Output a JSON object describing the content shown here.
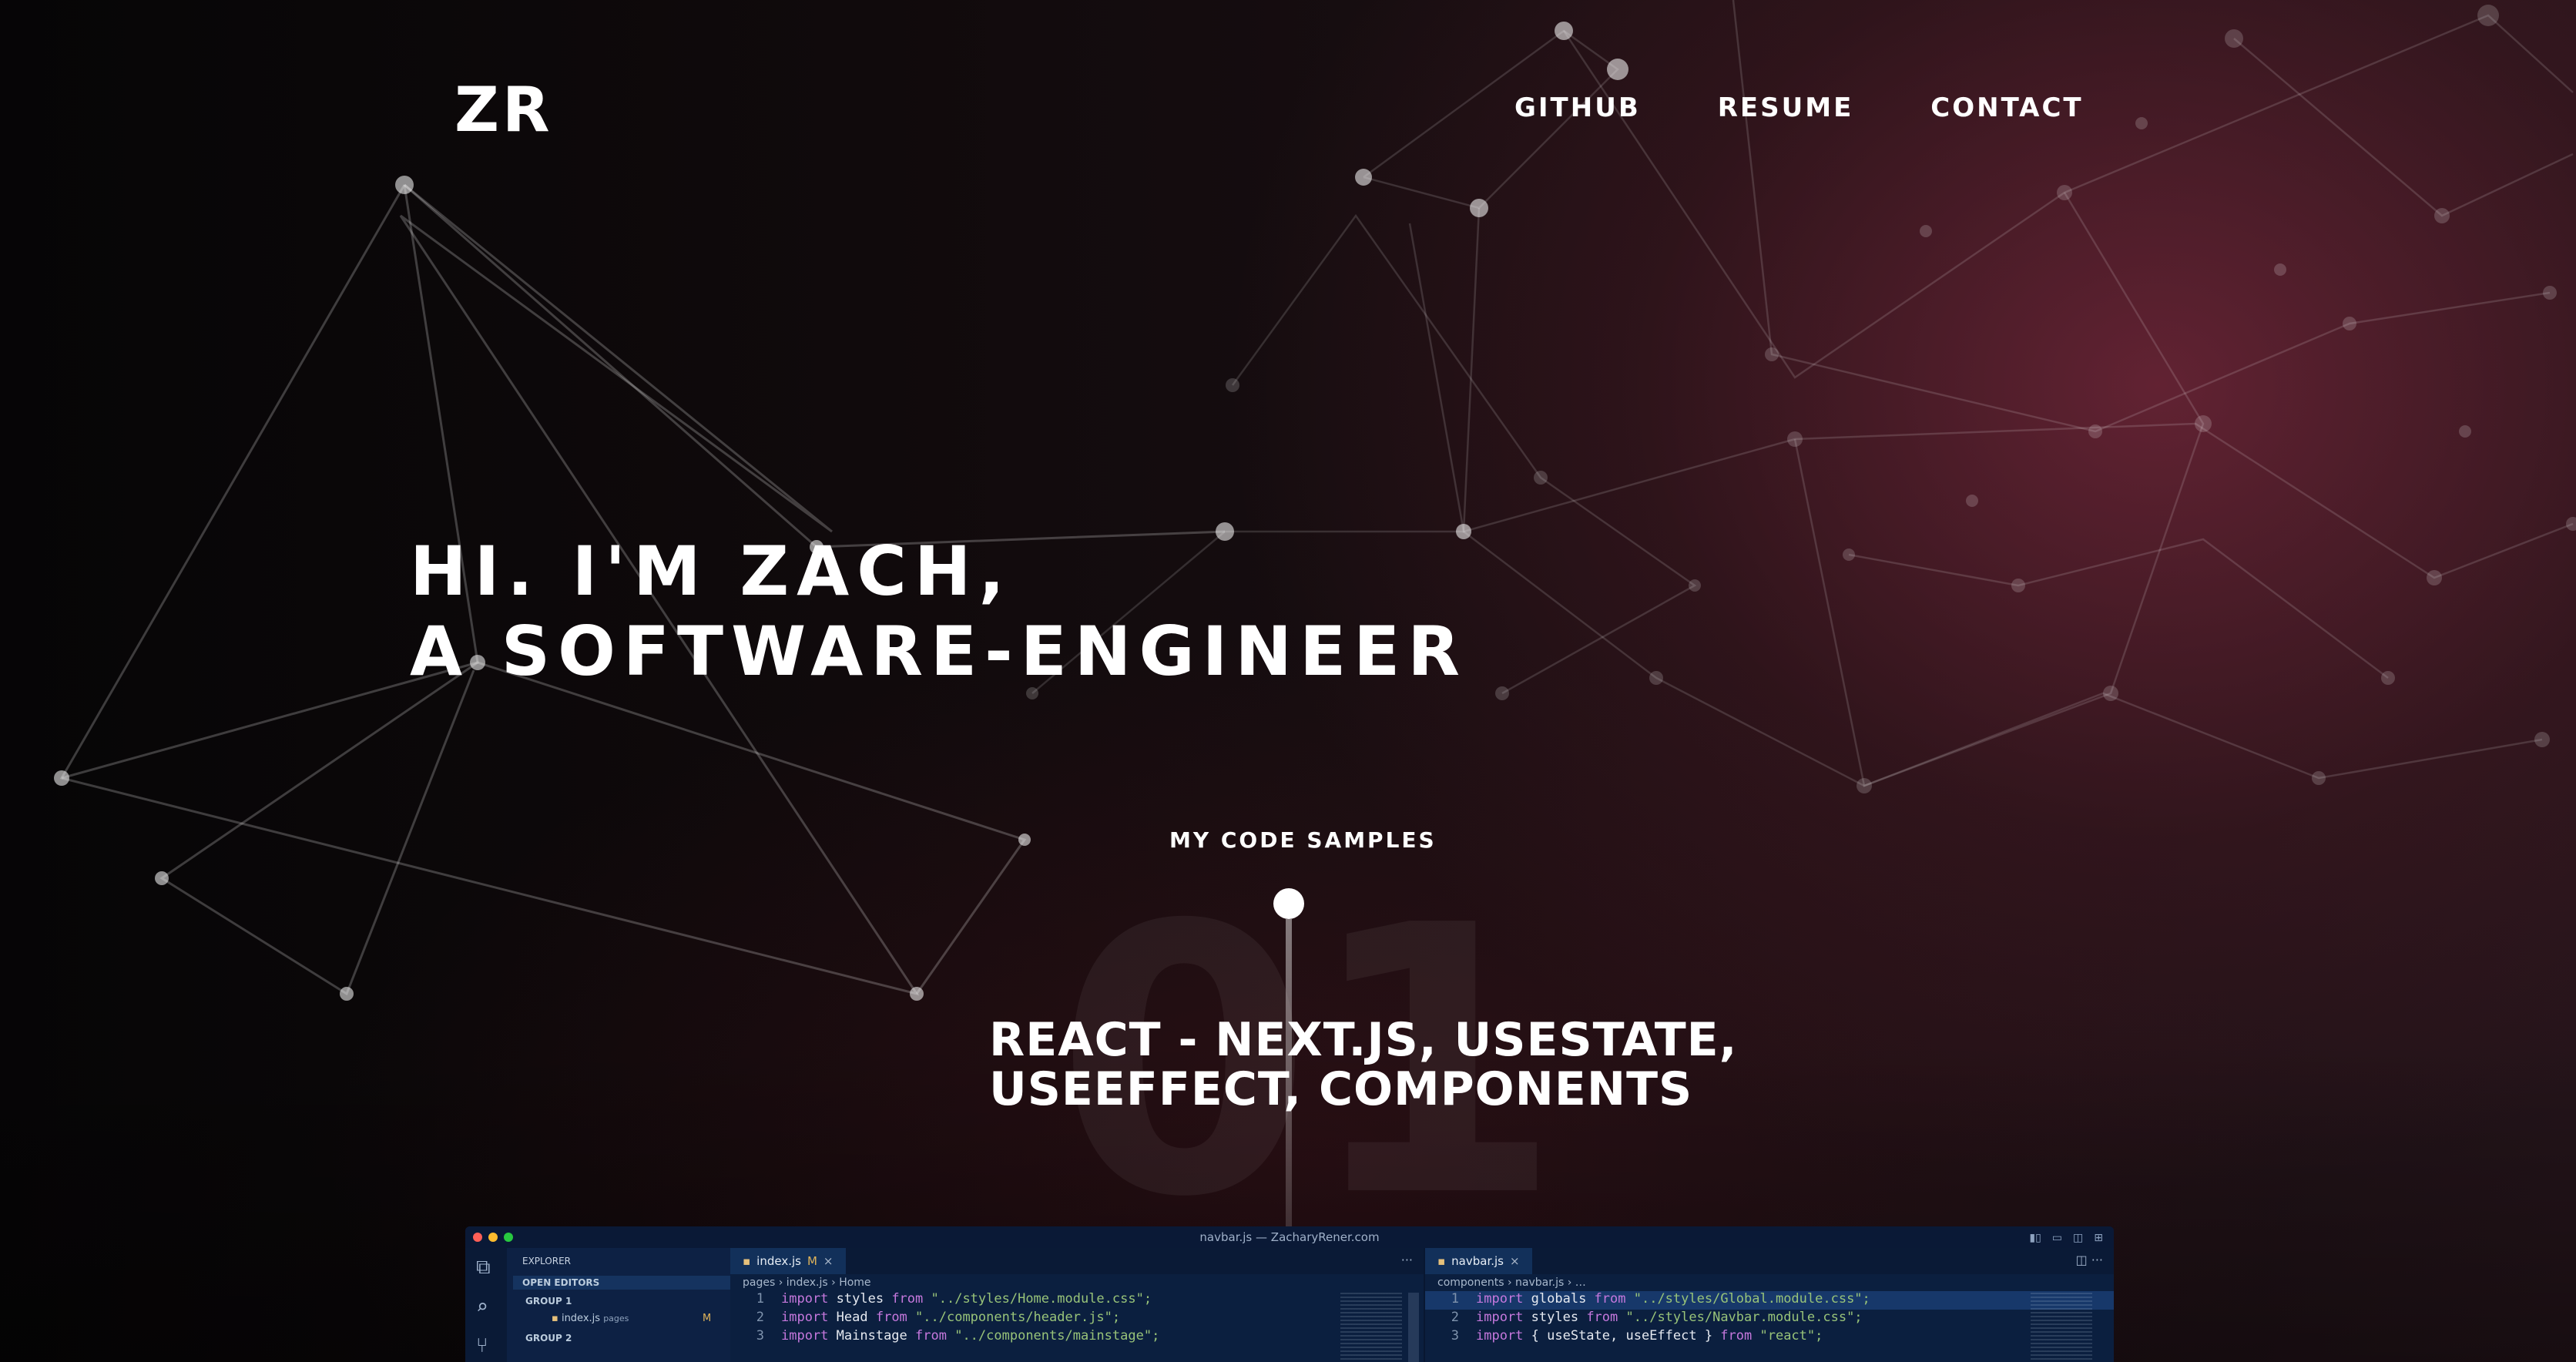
{
  "header": {
    "logo": "ZR",
    "nav": [
      {
        "label": "GITHUB"
      },
      {
        "label": "RESUME"
      },
      {
        "label": "CONTACT"
      }
    ]
  },
  "hero": {
    "line1": "HI. I'M ZACH,",
    "line2": "A SOFTWARE-ENGINEER"
  },
  "samples": {
    "label": "MY CODE SAMPLES",
    "number": "01",
    "title_line1": "REACT - NEXT.JS, USESTATE,",
    "title_line2": "USEEFFECT, COMPONENTS"
  },
  "editor": {
    "window_title": "navbar.js — ZacharyRener.com",
    "explorer": {
      "title": "EXPLORER",
      "open_editors": "OPEN EDITORS",
      "group1": "GROUP 1",
      "file": "index.js",
      "file_folder": "pages",
      "file_status": "M",
      "group2": "GROUP 2"
    },
    "left_pane": {
      "tab": "index.js",
      "tab_status": "M",
      "crumb": "pages › index.js › Home",
      "lines": [
        {
          "n": "1",
          "kw": "import",
          "id": " styles ",
          "kw2": "from",
          "str": " \"../styles/Home.module.css\";"
        },
        {
          "n": "2",
          "kw": "import",
          "id": " Head ",
          "kw2": "from",
          "str": " \"../components/header.js\";"
        },
        {
          "n": "3",
          "kw": "import",
          "id": " Mainstage ",
          "kw2": "from",
          "str": " \"../components/mainstage\";"
        }
      ]
    },
    "right_pane": {
      "tab": "navbar.js",
      "crumb": "components › navbar.js › …",
      "lines": [
        {
          "n": "1",
          "kw": "import",
          "id": " globals ",
          "kw2": "from",
          "str": " \"../styles/Global.module.css\";"
        },
        {
          "n": "2",
          "kw": "import",
          "id": " styles ",
          "kw2": "from",
          "str": " \"../styles/Navbar.module.css\";"
        },
        {
          "n": "3",
          "kw": "import",
          "id": " { useState, useEffect } ",
          "kw2": "from",
          "str": " \"react\";"
        }
      ]
    }
  },
  "colors": {
    "accent": "#8c1428",
    "background": "#0a0708",
    "editor_bg": "#0b1f3f"
  }
}
